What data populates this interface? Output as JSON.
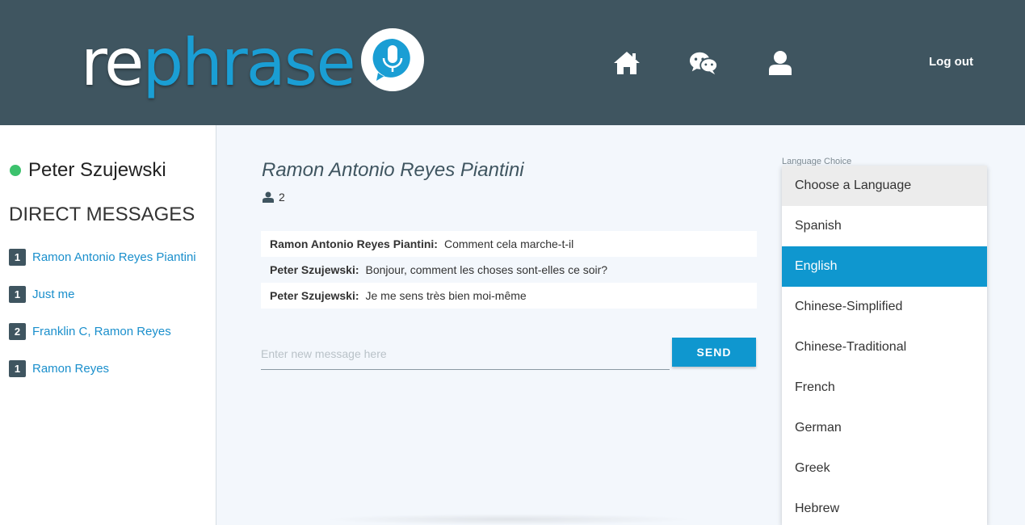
{
  "header": {
    "logo_part1": "re",
    "logo_part2": "phrase",
    "nav": [
      {
        "icon": "home-icon"
      },
      {
        "icon": "chat-icon"
      },
      {
        "icon": "user-icon"
      }
    ],
    "logout_label": "Log out"
  },
  "sidebar": {
    "current_user": "Peter Szujewski",
    "status_color": "#3cc26d",
    "section_title": "DIRECT MESSAGES",
    "items": [
      {
        "count": "1",
        "label": "Ramon Antonio Reyes Piantini"
      },
      {
        "count": "1",
        "label": "Just me"
      },
      {
        "count": "2",
        "label": "Franklin C, Ramon Reyes"
      },
      {
        "count": "1",
        "label": "Ramon Reyes"
      }
    ]
  },
  "conversation": {
    "title": "Ramon Antonio Reyes Piantini",
    "participant_count": "2",
    "messages": [
      {
        "sender": "Ramon Antonio Reyes Piantini:",
        "text": "Comment cela marche-t-il"
      },
      {
        "sender": "Peter Szujewski:",
        "text": "Bonjour, comment les choses sont-elles ce soir?"
      },
      {
        "sender": "Peter Szujewski:",
        "text": "Je me sens très bien moi-même"
      }
    ],
    "input_placeholder": "Enter new message here",
    "send_label": "SEND"
  },
  "language": {
    "caption": "Language Choice",
    "placeholder": "Choose a Language",
    "selected": "English",
    "options": [
      "Spanish",
      "English",
      "Chinese-Simplified",
      "Chinese-Traditional",
      "French",
      "German",
      "Greek",
      "Hebrew"
    ]
  },
  "colors": {
    "header_bg": "#3f5560",
    "accent": "#0f97cf",
    "link": "#1a8fcc"
  }
}
